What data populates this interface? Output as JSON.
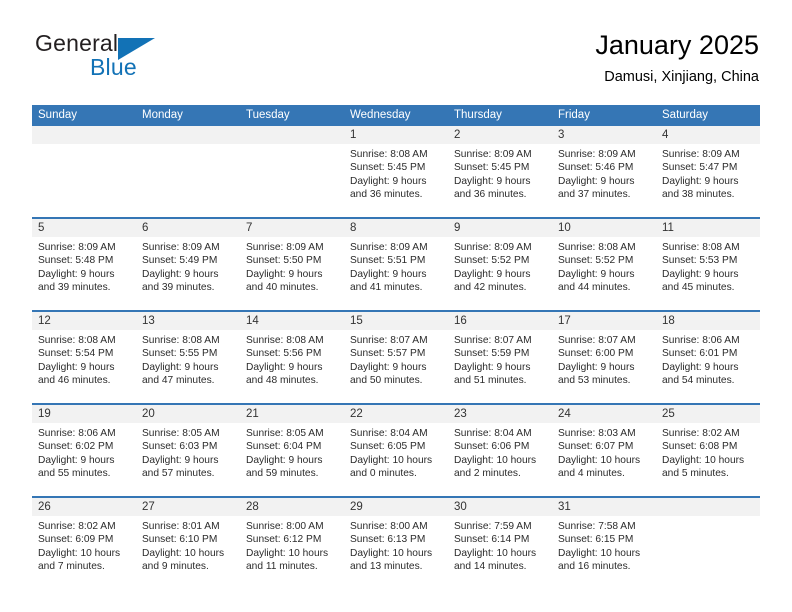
{
  "brand": {
    "line1": "General",
    "line2": "Blue",
    "triangle_icon": "blue-triangle-icon",
    "colors": {
      "text": "#231f20",
      "blue": "#1272b6"
    }
  },
  "header": {
    "title": "January 2025",
    "subtitle": "Damusi, Xinjiang, China"
  },
  "theme": {
    "header_blue": "#3576b5",
    "day_head_gray": "#f2f2f2",
    "background": "#ffffff"
  },
  "weekdays": [
    "Sunday",
    "Monday",
    "Tuesday",
    "Wednesday",
    "Thursday",
    "Friday",
    "Saturday"
  ],
  "weeks": [
    [
      {
        "date": "",
        "sunrise": "",
        "sunset": "",
        "daylight": ""
      },
      {
        "date": "",
        "sunrise": "",
        "sunset": "",
        "daylight": ""
      },
      {
        "date": "",
        "sunrise": "",
        "sunset": "",
        "daylight": ""
      },
      {
        "date": "1",
        "sunrise": "Sunrise: 8:08 AM",
        "sunset": "Sunset: 5:45 PM",
        "daylight": "Daylight: 9 hours and 36 minutes."
      },
      {
        "date": "2",
        "sunrise": "Sunrise: 8:09 AM",
        "sunset": "Sunset: 5:45 PM",
        "daylight": "Daylight: 9 hours and 36 minutes."
      },
      {
        "date": "3",
        "sunrise": "Sunrise: 8:09 AM",
        "sunset": "Sunset: 5:46 PM",
        "daylight": "Daylight: 9 hours and 37 minutes."
      },
      {
        "date": "4",
        "sunrise": "Sunrise: 8:09 AM",
        "sunset": "Sunset: 5:47 PM",
        "daylight": "Daylight: 9 hours and 38 minutes."
      }
    ],
    [
      {
        "date": "5",
        "sunrise": "Sunrise: 8:09 AM",
        "sunset": "Sunset: 5:48 PM",
        "daylight": "Daylight: 9 hours and 39 minutes."
      },
      {
        "date": "6",
        "sunrise": "Sunrise: 8:09 AM",
        "sunset": "Sunset: 5:49 PM",
        "daylight": "Daylight: 9 hours and 39 minutes."
      },
      {
        "date": "7",
        "sunrise": "Sunrise: 8:09 AM",
        "sunset": "Sunset: 5:50 PM",
        "daylight": "Daylight: 9 hours and 40 minutes."
      },
      {
        "date": "8",
        "sunrise": "Sunrise: 8:09 AM",
        "sunset": "Sunset: 5:51 PM",
        "daylight": "Daylight: 9 hours and 41 minutes."
      },
      {
        "date": "9",
        "sunrise": "Sunrise: 8:09 AM",
        "sunset": "Sunset: 5:52 PM",
        "daylight": "Daylight: 9 hours and 42 minutes."
      },
      {
        "date": "10",
        "sunrise": "Sunrise: 8:08 AM",
        "sunset": "Sunset: 5:52 PM",
        "daylight": "Daylight: 9 hours and 44 minutes."
      },
      {
        "date": "11",
        "sunrise": "Sunrise: 8:08 AM",
        "sunset": "Sunset: 5:53 PM",
        "daylight": "Daylight: 9 hours and 45 minutes."
      }
    ],
    [
      {
        "date": "12",
        "sunrise": "Sunrise: 8:08 AM",
        "sunset": "Sunset: 5:54 PM",
        "daylight": "Daylight: 9 hours and 46 minutes."
      },
      {
        "date": "13",
        "sunrise": "Sunrise: 8:08 AM",
        "sunset": "Sunset: 5:55 PM",
        "daylight": "Daylight: 9 hours and 47 minutes."
      },
      {
        "date": "14",
        "sunrise": "Sunrise: 8:08 AM",
        "sunset": "Sunset: 5:56 PM",
        "daylight": "Daylight: 9 hours and 48 minutes."
      },
      {
        "date": "15",
        "sunrise": "Sunrise: 8:07 AM",
        "sunset": "Sunset: 5:57 PM",
        "daylight": "Daylight: 9 hours and 50 minutes."
      },
      {
        "date": "16",
        "sunrise": "Sunrise: 8:07 AM",
        "sunset": "Sunset: 5:59 PM",
        "daylight": "Daylight: 9 hours and 51 minutes."
      },
      {
        "date": "17",
        "sunrise": "Sunrise: 8:07 AM",
        "sunset": "Sunset: 6:00 PM",
        "daylight": "Daylight: 9 hours and 53 minutes."
      },
      {
        "date": "18",
        "sunrise": "Sunrise: 8:06 AM",
        "sunset": "Sunset: 6:01 PM",
        "daylight": "Daylight: 9 hours and 54 minutes."
      }
    ],
    [
      {
        "date": "19",
        "sunrise": "Sunrise: 8:06 AM",
        "sunset": "Sunset: 6:02 PM",
        "daylight": "Daylight: 9 hours and 55 minutes."
      },
      {
        "date": "20",
        "sunrise": "Sunrise: 8:05 AM",
        "sunset": "Sunset: 6:03 PM",
        "daylight": "Daylight: 9 hours and 57 minutes."
      },
      {
        "date": "21",
        "sunrise": "Sunrise: 8:05 AM",
        "sunset": "Sunset: 6:04 PM",
        "daylight": "Daylight: 9 hours and 59 minutes."
      },
      {
        "date": "22",
        "sunrise": "Sunrise: 8:04 AM",
        "sunset": "Sunset: 6:05 PM",
        "daylight": "Daylight: 10 hours and 0 minutes."
      },
      {
        "date": "23",
        "sunrise": "Sunrise: 8:04 AM",
        "sunset": "Sunset: 6:06 PM",
        "daylight": "Daylight: 10 hours and 2 minutes."
      },
      {
        "date": "24",
        "sunrise": "Sunrise: 8:03 AM",
        "sunset": "Sunset: 6:07 PM",
        "daylight": "Daylight: 10 hours and 4 minutes."
      },
      {
        "date": "25",
        "sunrise": "Sunrise: 8:02 AM",
        "sunset": "Sunset: 6:08 PM",
        "daylight": "Daylight: 10 hours and 5 minutes."
      }
    ],
    [
      {
        "date": "26",
        "sunrise": "Sunrise: 8:02 AM",
        "sunset": "Sunset: 6:09 PM",
        "daylight": "Daylight: 10 hours and 7 minutes."
      },
      {
        "date": "27",
        "sunrise": "Sunrise: 8:01 AM",
        "sunset": "Sunset: 6:10 PM",
        "daylight": "Daylight: 10 hours and 9 minutes."
      },
      {
        "date": "28",
        "sunrise": "Sunrise: 8:00 AM",
        "sunset": "Sunset: 6:12 PM",
        "daylight": "Daylight: 10 hours and 11 minutes."
      },
      {
        "date": "29",
        "sunrise": "Sunrise: 8:00 AM",
        "sunset": "Sunset: 6:13 PM",
        "daylight": "Daylight: 10 hours and 13 minutes."
      },
      {
        "date": "30",
        "sunrise": "Sunrise: 7:59 AM",
        "sunset": "Sunset: 6:14 PM",
        "daylight": "Daylight: 10 hours and 14 minutes."
      },
      {
        "date": "31",
        "sunrise": "Sunrise: 7:58 AM",
        "sunset": "Sunset: 6:15 PM",
        "daylight": "Daylight: 10 hours and 16 minutes."
      },
      {
        "date": "",
        "sunrise": "",
        "sunset": "",
        "daylight": ""
      }
    ]
  ]
}
